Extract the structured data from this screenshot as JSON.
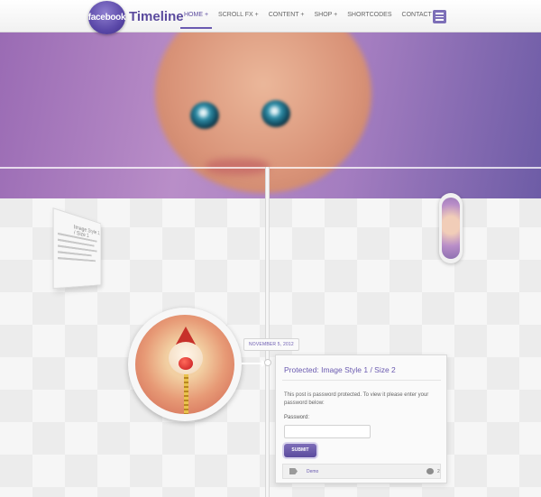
{
  "header": {
    "logo_badge": "facebook",
    "logo_text": "Timeline",
    "nav": [
      {
        "label": "HOME +",
        "active": true
      },
      {
        "label": "SCROLL FX +",
        "active": false
      },
      {
        "label": "CONTENT +",
        "active": false
      },
      {
        "label": "SHOP +",
        "active": false
      },
      {
        "label": "SHORTCODES",
        "active": false
      },
      {
        "label": "CONTACT US",
        "active": false
      }
    ],
    "menu_icon": "hamburger-icon"
  },
  "tilted_post": {
    "title": "Image Style 1 / Size 1"
  },
  "post": {
    "date": "NOVEMBER 5, 2012",
    "title": "Protected: Image Style 1 / Size 2",
    "body": "This post is password protected. To view it please enter your password below:",
    "password_label": "Password:",
    "password_value": "",
    "submit_label": "SUBMIT",
    "tag": "Demo",
    "comment_count": "2"
  },
  "colors": {
    "accent": "#6a5ab0",
    "hero": "#a47dc0"
  }
}
